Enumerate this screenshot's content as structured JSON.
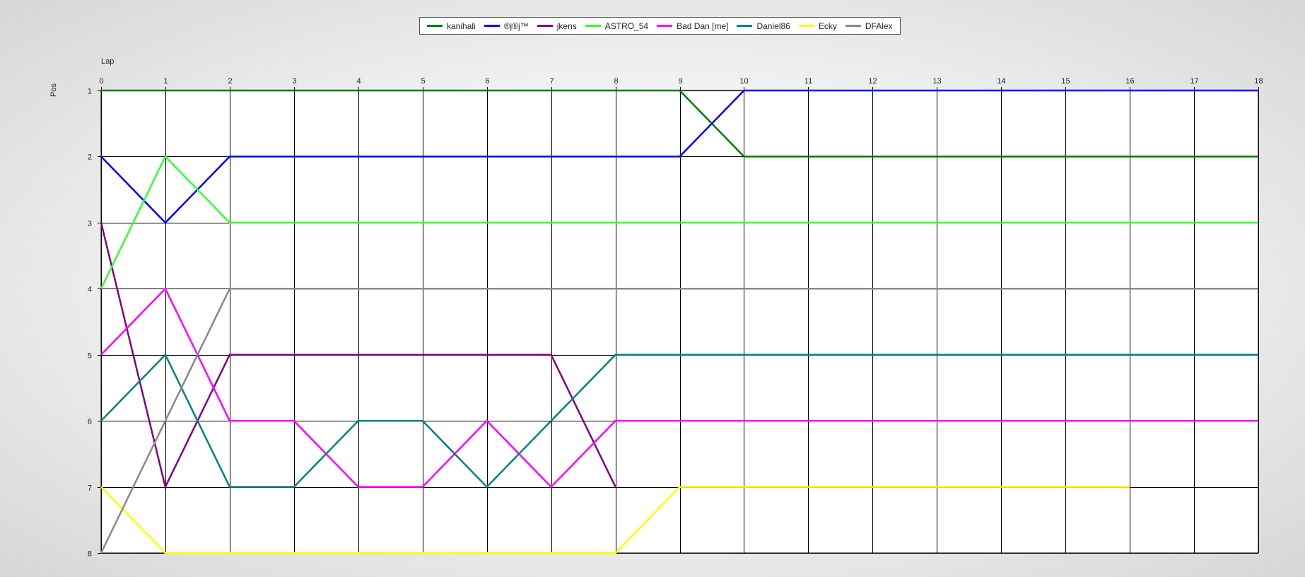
{
  "chart_data": {
    "type": "line",
    "xlabel": "Lap",
    "ylabel": "Pos",
    "xlim": [
      0,
      18
    ],
    "ylim": [
      1,
      8
    ],
    "y_inverted": true,
    "grid": true,
    "legend_position": "top-center",
    "x": [
      0,
      1,
      2,
      3,
      4,
      5,
      6,
      7,
      8,
      9,
      10,
      11,
      12,
      13,
      14,
      15,
      16,
      17,
      18
    ],
    "x_ticks": [
      "0",
      "1",
      "2",
      "3",
      "4",
      "5",
      "6",
      "7",
      "8",
      "9",
      "10",
      "11",
      "12",
      "13",
      "14",
      "15",
      "16",
      "17",
      "18"
    ],
    "y_ticks": [
      "1",
      "2",
      "3",
      "4",
      "5",
      "6",
      "7",
      "8"
    ],
    "series": [
      {
        "name": "kanihali",
        "color": "#007a00",
        "values": [
          1,
          1,
          1,
          1,
          1,
          1,
          1,
          1,
          1,
          1,
          2,
          2,
          2,
          2,
          2,
          2,
          2,
          2,
          2
        ]
      },
      {
        "name": "®j®j™",
        "color": "#0000ff",
        "values": [
          2,
          3,
          2,
          2,
          2,
          2,
          2,
          2,
          2,
          2,
          1,
          1,
          1,
          1,
          1,
          1,
          1,
          1,
          1
        ]
      },
      {
        "name": "jkens",
        "color": "#800080",
        "values": [
          3,
          7,
          5,
          5,
          5,
          5,
          5,
          5,
          7
        ]
      },
      {
        "name": "ASTRO_54",
        "color": "#33ff33",
        "values": [
          4,
          2,
          3,
          3,
          3,
          3,
          3,
          3,
          3,
          3,
          3,
          3,
          3,
          3,
          3,
          3,
          3,
          3,
          3
        ]
      },
      {
        "name": "Bad Dan [me]",
        "color": "#ff00ff",
        "values": [
          5,
          4,
          6,
          6,
          7,
          7,
          6,
          7,
          6,
          6,
          6,
          6,
          6,
          6,
          6,
          6,
          6,
          6,
          6
        ]
      },
      {
        "name": "Daniel86",
        "color": "#008080",
        "values": [
          6,
          5,
          7,
          7,
          6,
          6,
          7,
          6,
          5,
          5,
          5,
          5,
          5,
          5,
          5,
          5,
          5,
          5,
          5
        ]
      },
      {
        "name": "Ecky",
        "color": "#ffff00",
        "values": [
          7,
          8,
          8,
          8,
          8,
          8,
          8,
          8,
          8,
          7,
          7,
          7,
          7,
          7,
          7,
          7,
          7
        ]
      },
      {
        "name": "DFAlex",
        "color": "#888888",
        "values": [
          8,
          6,
          4,
          4,
          4,
          4,
          4,
          4,
          4,
          4,
          4,
          4,
          4,
          4,
          4,
          4,
          4,
          4,
          4
        ]
      }
    ]
  }
}
